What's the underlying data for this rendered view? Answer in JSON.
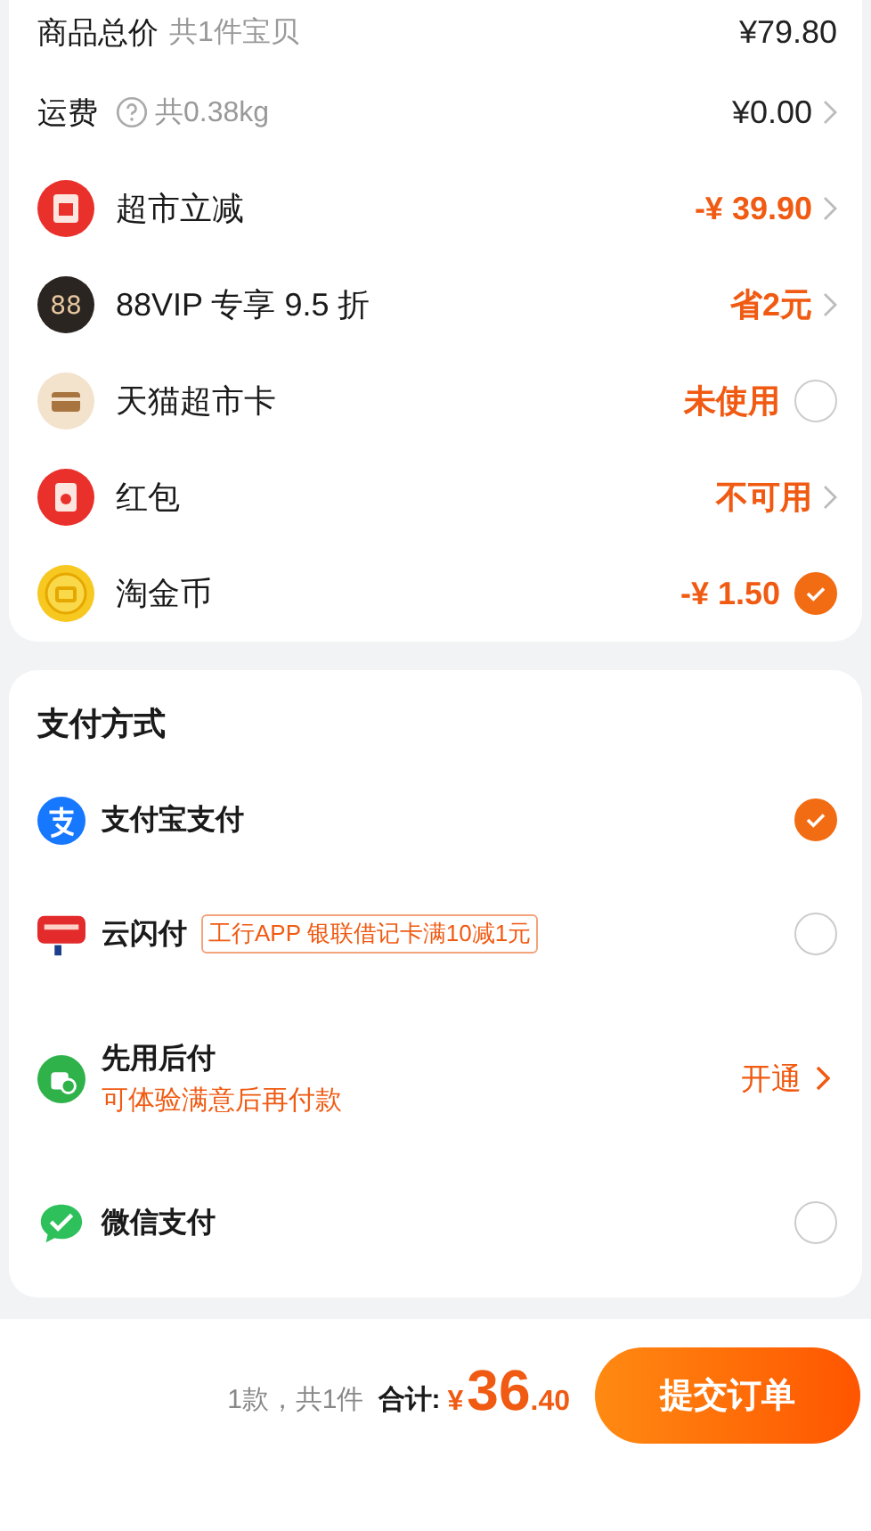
{
  "price_rows": [
    {
      "kind": "plain",
      "label": "商品总价",
      "sub": "共1件宝贝",
      "help": false,
      "value": "¥79.80",
      "highlight": false
    },
    {
      "kind": "link",
      "label": "运费",
      "sub": "共0.38kg",
      "help": true,
      "value": "¥0.00",
      "highlight": false
    },
    {
      "kind": "link",
      "label": "超市立减",
      "value": "-¥ 39.90",
      "highlight": true
    },
    {
      "kind": "link",
      "badge": "88",
      "label": "88VIP 专享 9.5 折",
      "value": "省2元",
      "highlight": true
    },
    {
      "kind": "check",
      "label": "天猫超市卡",
      "value": "未使用",
      "highlight": true,
      "checked": false
    },
    {
      "kind": "link",
      "label": "红包",
      "value": "不可用",
      "highlight": true
    },
    {
      "kind": "check",
      "label": "淘金币",
      "value": "-¥ 1.50",
      "highlight": true,
      "checked": true
    }
  ],
  "payment": {
    "title": "支付方式",
    "methods": [
      {
        "kind": "radio",
        "name": "支付宝支付",
        "selected": true
      },
      {
        "kind": "radio",
        "name": "云闪付",
        "tag": "工行APP 银联借记卡满10减1元",
        "selected": false
      },
      {
        "kind": "link",
        "name": "先用后付",
        "note": "可体验满意后再付款",
        "action": "开通"
      },
      {
        "kind": "radio",
        "name": "微信支付",
        "selected": false
      }
    ]
  },
  "footer": {
    "summary": "1款，共1件",
    "total_label": "合计:",
    "currency": "¥",
    "integer": "36",
    "decimal": ".40",
    "submit": "提交订单"
  }
}
